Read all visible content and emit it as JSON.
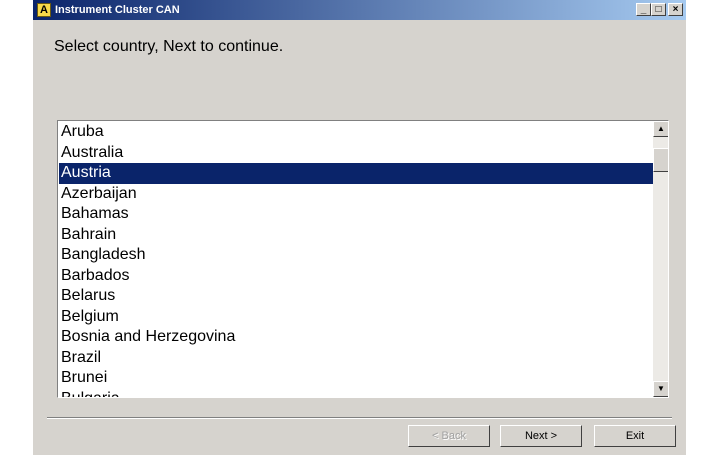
{
  "window": {
    "title": "Instrument Cluster CAN",
    "icon_letter": "A",
    "controls": {
      "minimize": "_",
      "maximize": "□",
      "close": "×"
    }
  },
  "prompt": "Select country, Next to continue.",
  "countries": [
    "Aruba",
    "Australia",
    "Austria",
    "Azerbaijan",
    "Bahamas",
    "Bahrain",
    "Bangladesh",
    "Barbados",
    "Belarus",
    "Belgium",
    "Bosnia and Herzegovina",
    "Brazil",
    "Brunei",
    "Bulgaria"
  ],
  "selected_country": "Austria",
  "scrollbar": {
    "up_arrow": "▲",
    "down_arrow": "▼"
  },
  "buttons": {
    "back": "< Back",
    "next": "Next >",
    "exit": "Exit"
  },
  "colors": {
    "selection": "#0a246a",
    "dialog_face": "#d6d3ce",
    "titlebar": "#0a246a"
  }
}
